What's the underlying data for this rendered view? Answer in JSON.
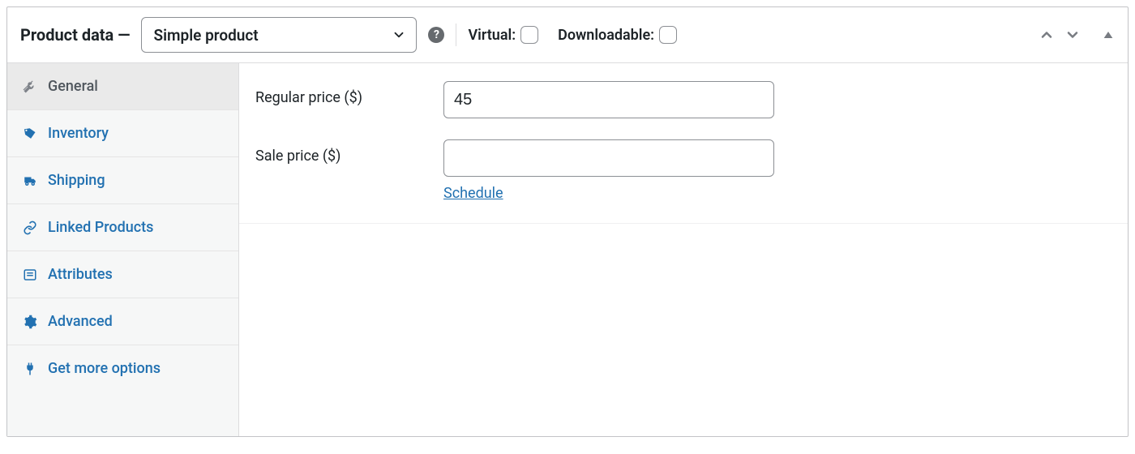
{
  "header": {
    "title": "Product data —",
    "product_type": "Simple product",
    "virtual_label": "Virtual:",
    "downloadable_label": "Downloadable:"
  },
  "sidebar": {
    "items": [
      {
        "label": "General"
      },
      {
        "label": "Inventory"
      },
      {
        "label": "Shipping"
      },
      {
        "label": "Linked Products"
      },
      {
        "label": "Attributes"
      },
      {
        "label": "Advanced"
      },
      {
        "label": "Get more options"
      }
    ]
  },
  "form": {
    "regular_price_label": "Regular price ($)",
    "regular_price_value": "45",
    "sale_price_label": "Sale price ($)",
    "sale_price_value": "",
    "schedule_link": "Schedule"
  },
  "colors": {
    "link": "#2271b1",
    "muted": "#787c82",
    "border": "#8c8f94"
  }
}
